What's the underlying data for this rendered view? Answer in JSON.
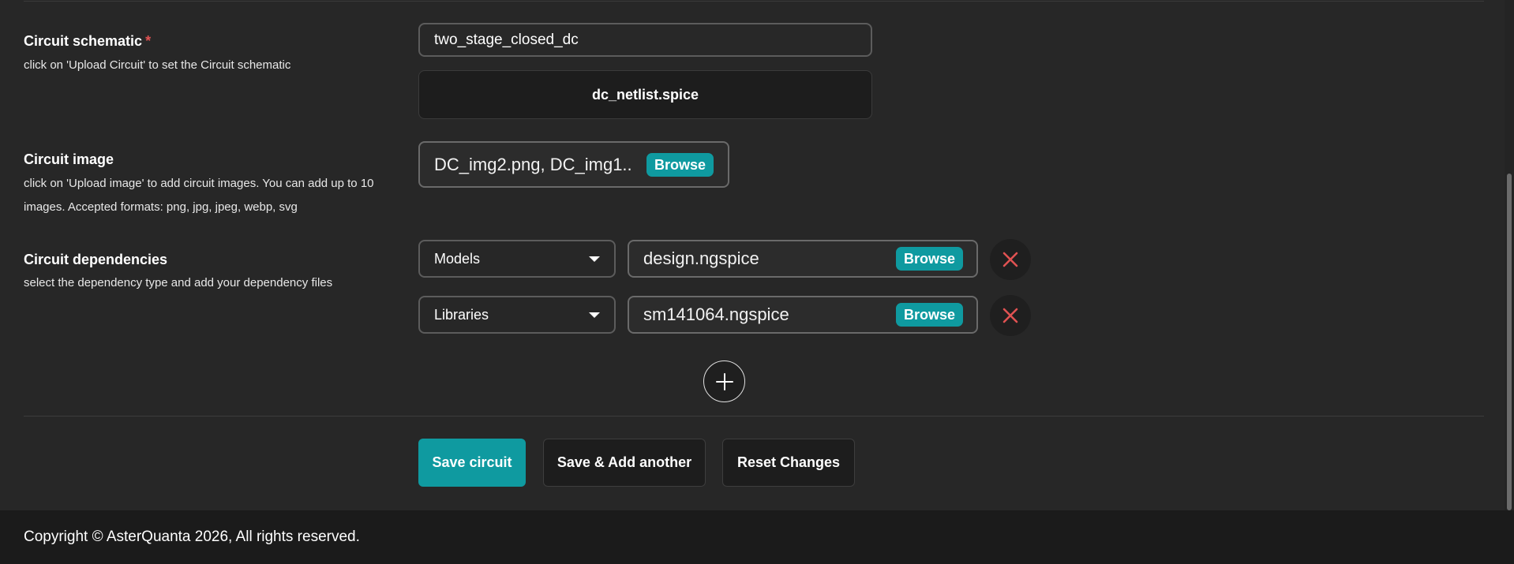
{
  "schematic": {
    "title": "Circuit schematic",
    "required_mark": "*",
    "description": "click on 'Upload Circuit' to set the Circuit schematic",
    "name_value": "two_stage_closed_dc",
    "upload_file": "dc_netlist.spice"
  },
  "image": {
    "title": "Circuit image",
    "description": "click on 'Upload image' to add circuit images. You can add up to 10 images. Accepted formats: png, jpg, jpeg, webp, svg",
    "files": "DC_img2.png, DC_img1....",
    "browse_label": "Browse"
  },
  "dependencies": {
    "title": "Circuit dependencies",
    "description": "select the dependency type and add your dependency files",
    "rows": [
      {
        "type": "Models",
        "file": "design.ngspice",
        "browse_label": "Browse"
      },
      {
        "type": "Libraries",
        "file": "sm141064.ngspice",
        "browse_label": "Browse"
      }
    ]
  },
  "actions": {
    "save_label": "Save circuit",
    "save_add_label": "Save & Add another",
    "reset_label": "Reset Changes"
  },
  "footer": {
    "copyright": "Copyright © AsterQuanta 2026, All rights reserved."
  },
  "colors": {
    "accent": "#0f9aa0",
    "danger": "#e05252",
    "background": "#272727"
  },
  "icons": {
    "remove": "close-icon",
    "add": "plus-icon",
    "dropdown": "chevron-down-icon"
  }
}
